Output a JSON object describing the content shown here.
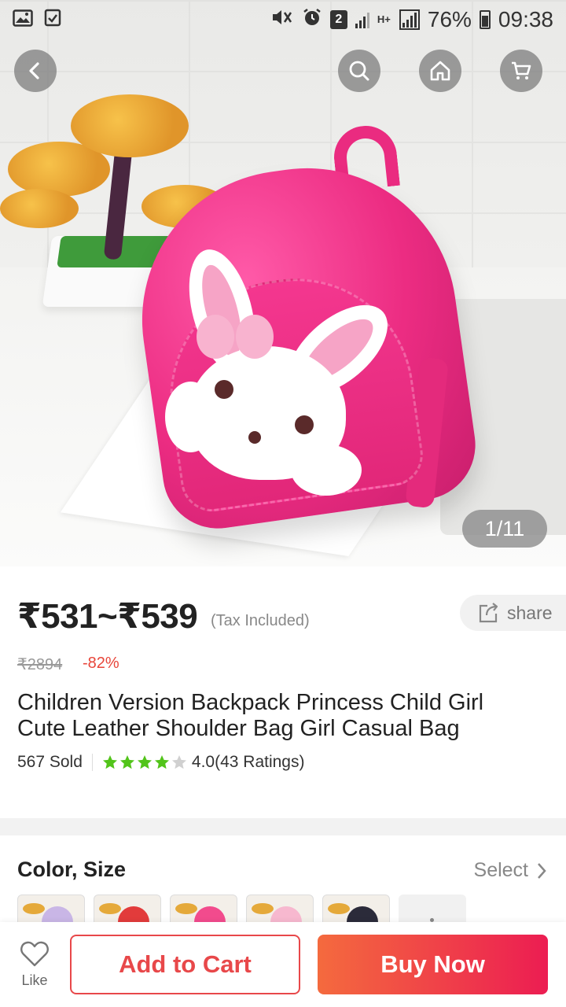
{
  "status_bar": {
    "battery_percent": "76%",
    "time": "09:38",
    "sim_badge": "2",
    "network": "H+"
  },
  "hero": {
    "image_counter": "1/11",
    "buttons": {
      "back": "back-icon",
      "search": "search-icon",
      "home": "home-icon",
      "cart": "cart-icon"
    }
  },
  "product": {
    "price_range": "₹531~₹539",
    "tax_note": "(Tax Included)",
    "share_label": "share",
    "original_price": "₹2894",
    "discount": "-82%",
    "title": "Children Version Backpack Princess Child Girl Cute Leather Shoulder Bag Girl Casual Bag",
    "sold": "567 Sold",
    "rating_value": 4.0,
    "rating_text": "4.0(43 Ratings)"
  },
  "options": {
    "title": "Color, Size",
    "select_label": "Select",
    "thumb_colors": [
      "#c9b6e6",
      "#e23b3b",
      "#f24b8d",
      "#f7b8cf",
      "#2b2b3a"
    ]
  },
  "bottom_bar": {
    "like_label": "Like",
    "add_to_cart": "Add to Cart",
    "buy_now": "Buy Now"
  },
  "colors": {
    "accent_red": "#e8484a",
    "buy_gradient_start": "#f46a3e",
    "buy_gradient_end": "#ec1d52",
    "star_green": "#52c41a",
    "discount_red": "#e8463a"
  }
}
